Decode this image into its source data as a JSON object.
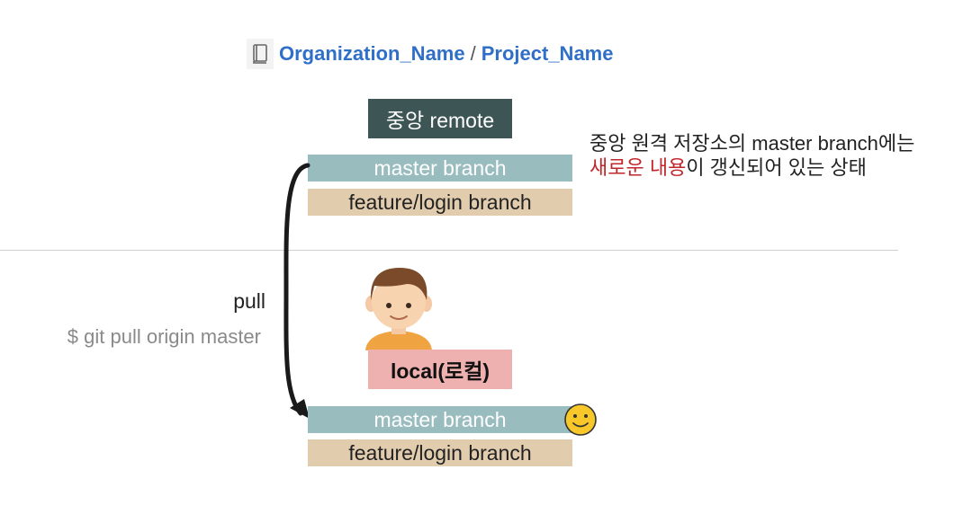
{
  "header": {
    "icon": "book-icon",
    "organization": "Organization_Name",
    "separator": "/",
    "project": "Project_Name"
  },
  "remote": {
    "label": "중앙 remote",
    "master_branch": "master branch",
    "feature_branch": "feature/login branch"
  },
  "note": {
    "line1": "중앙 원격 저장소의 master branch에는",
    "highlight": "새로운 내용",
    "line2_rest": "이 갱신되어 있는 상태"
  },
  "action": {
    "label": "pull",
    "command": "$ git pull origin master"
  },
  "local": {
    "label": "local(로컬)",
    "master_branch": "master branch",
    "feature_branch": "feature/login branch",
    "status_icon": "smiley-icon"
  },
  "colors": {
    "link": "#2f6fc7",
    "remote_label_bg": "#3e5556",
    "master_bar": "#99bcbf",
    "feature_bar": "#e2ccae",
    "local_label_bg": "#eeb1b0",
    "highlight_text": "#c0262b",
    "smiley": "#f8c72a"
  }
}
